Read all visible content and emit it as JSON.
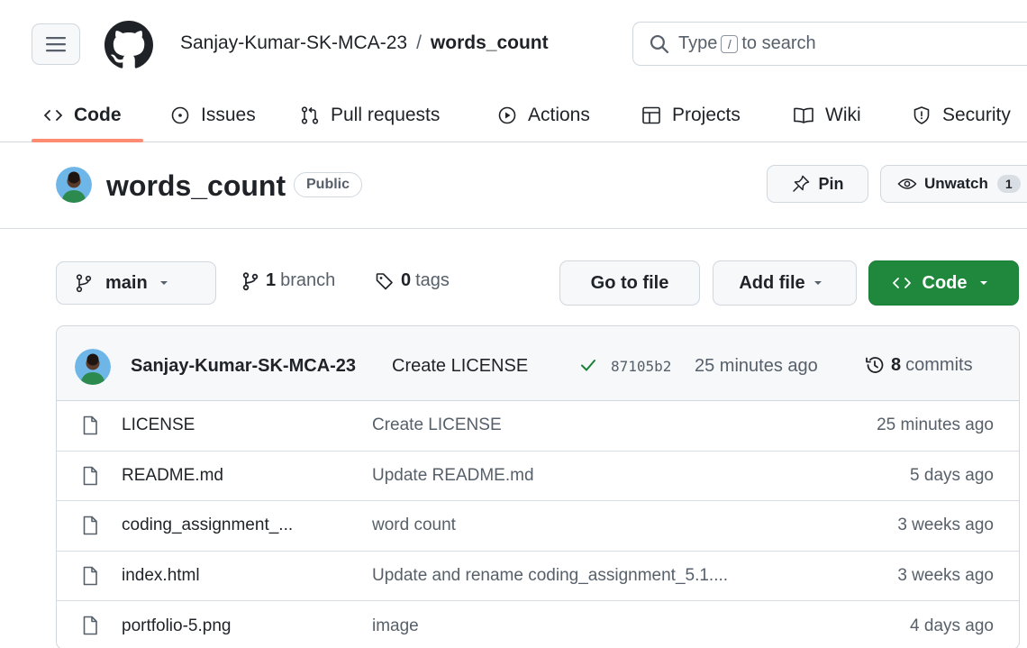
{
  "header": {
    "owner": "Sanjay-Kumar-SK-MCA-23",
    "separator": "/",
    "repo": "words_count",
    "search_prefix": "Type",
    "search_key": "/",
    "search_suffix": "to search"
  },
  "nav": {
    "items": [
      {
        "label": "Code",
        "icon": "code-icon"
      },
      {
        "label": "Issues",
        "icon": "issue-opened-icon"
      },
      {
        "label": "Pull requests",
        "icon": "git-pull-request-icon"
      },
      {
        "label": "Actions",
        "icon": "play-icon"
      },
      {
        "label": "Projects",
        "icon": "table-icon"
      },
      {
        "label": "Wiki",
        "icon": "book-icon"
      },
      {
        "label": "Security",
        "icon": "shield-icon"
      }
    ]
  },
  "repo": {
    "title": "words_count",
    "visibility": "Public",
    "pin_label": "Pin",
    "unwatch_label": "Unwatch",
    "watch_count": "1"
  },
  "branch_bar": {
    "branch": "main",
    "branch_count": "1",
    "branch_word": "branch",
    "tag_count": "0",
    "tag_word": "tags",
    "goto_label": "Go to file",
    "addfile_label": "Add file",
    "code_label": "Code"
  },
  "latest_commit": {
    "author": "Sanjay-Kumar-SK-MCA-23",
    "message": "Create LICENSE",
    "sha": "87105b2",
    "time": "25 minutes ago",
    "commit_count": "8",
    "commit_word": "commits"
  },
  "files": [
    {
      "name": "LICENSE",
      "commit": "Create LICENSE",
      "time": "25 minutes ago"
    },
    {
      "name": "README.md",
      "commit": "Update README.md",
      "time": "5 days ago"
    },
    {
      "name": "coding_assignment_...",
      "commit": "word count",
      "time": "3 weeks ago"
    },
    {
      "name": "index.html",
      "commit": "Update and rename coding_assignment_5.1....",
      "time": "3 weeks ago"
    },
    {
      "name": "portfolio-5.png",
      "commit": "image",
      "time": "4 days ago"
    }
  ],
  "colors": {
    "accent_underline": "#fd8c73",
    "primary_button": "#1f883d",
    "success_check": "#1a7f37"
  }
}
